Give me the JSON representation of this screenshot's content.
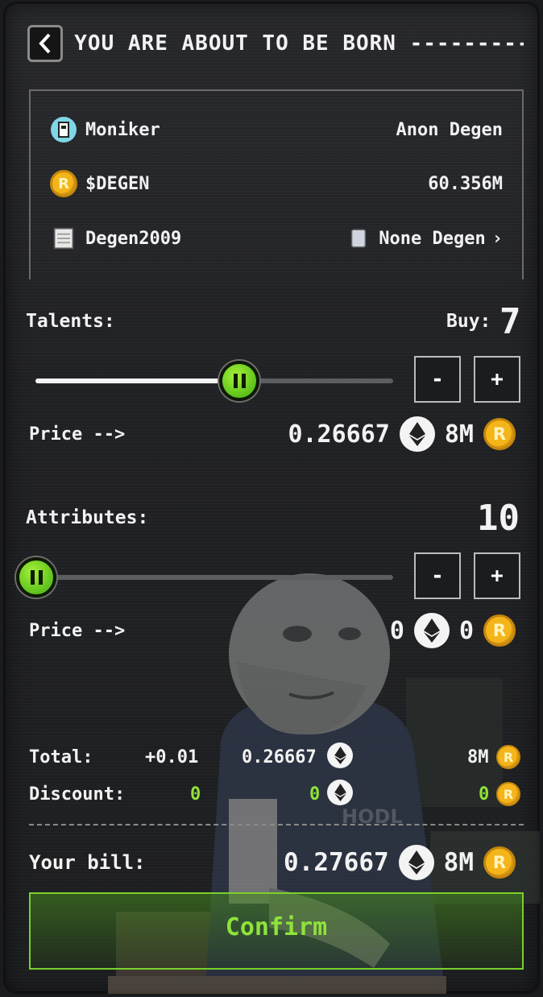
{
  "header": {
    "title": "YOU ARE ABOUT TO BE BORN ----------"
  },
  "info": {
    "moniker_label": "Moniker",
    "moniker_value": "Anon Degen",
    "degen_label": "$DEGEN",
    "degen_value": "60.356M",
    "degen2009_label": "Degen2009",
    "none_degen_value": "None Degen",
    "chevron": "›"
  },
  "talents": {
    "label": "Talents:",
    "buy_label": "Buy:",
    "buy_value": "7",
    "slider_fraction": 0.57,
    "minus": "-",
    "plus": "+",
    "price_label": "Price -->",
    "price_eth": "0.26667",
    "price_coin": "8M"
  },
  "attributes": {
    "label": "Attributes:",
    "value": "10",
    "slider_fraction": 0.0,
    "minus": "-",
    "plus": "+",
    "price_label": "Price -->",
    "price_eth": "0",
    "price_coin": "0"
  },
  "summary": {
    "total_label": "Total:",
    "total_extra": "+0.01",
    "total_eth": "0.26667",
    "total_coin": "8M",
    "discount_label": "Discount:",
    "discount_extra": "0",
    "discount_eth": "0",
    "discount_coin": "0"
  },
  "bill": {
    "label": "Your bill:",
    "eth": "0.27667",
    "coin": "8M"
  },
  "confirm_label": "Confirm",
  "icons": {
    "coin_letter": "R",
    "back": "chevron-left-icon",
    "eth": "ethereum-icon",
    "coin": "degen-coin-icon"
  },
  "colors": {
    "accent_green": "#8ee33a",
    "coin_gold": "#f4b51b"
  }
}
